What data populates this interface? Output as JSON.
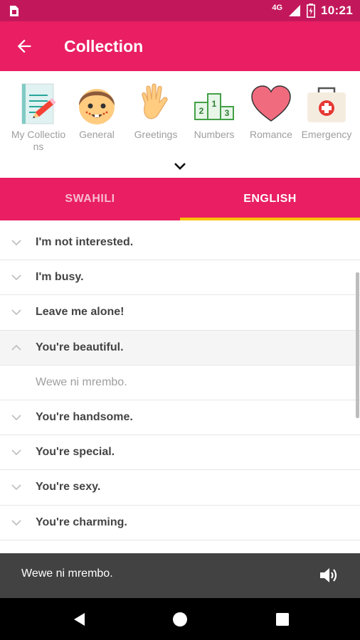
{
  "status_bar": {
    "network": "4G",
    "time": "10:21"
  },
  "app_bar": {
    "title": "Collection",
    "back_icon": "arrow-back-icon"
  },
  "categories": [
    {
      "label": "My Collections",
      "icon": "notebook-pencil-icon"
    },
    {
      "label": "General",
      "icon": "smiling-face-icon"
    },
    {
      "label": "Greetings",
      "icon": "waving-hand-icon"
    },
    {
      "label": "Numbers",
      "icon": "podium-icon"
    },
    {
      "label": "Romance",
      "icon": "heart-icon"
    },
    {
      "label": "Emergency",
      "icon": "first-aid-kit-icon"
    }
  ],
  "tabs": [
    {
      "label": "SWAHILI",
      "active": false
    },
    {
      "label": "ENGLISH",
      "active": true
    }
  ],
  "phrases": [
    {
      "text": "I'm not interested.",
      "expanded": false
    },
    {
      "text": "I'm busy.",
      "expanded": false
    },
    {
      "text": "Leave me alone!",
      "expanded": false
    },
    {
      "text": "You're beautiful.",
      "expanded": true,
      "translation": "Wewe ni mrembo."
    },
    {
      "text": "You're handsome.",
      "expanded": false
    },
    {
      "text": "You're special.",
      "expanded": false
    },
    {
      "text": "You're sexy.",
      "expanded": false
    },
    {
      "text": "You're charming.",
      "expanded": false
    }
  ],
  "player": {
    "text": "Wewe ni mrembo.",
    "icon": "volume-icon"
  },
  "colors": {
    "status_bar": "#c2185b",
    "primary": "#e91e63",
    "tab_indicator": "#ffc107",
    "player_bg": "#424242"
  }
}
